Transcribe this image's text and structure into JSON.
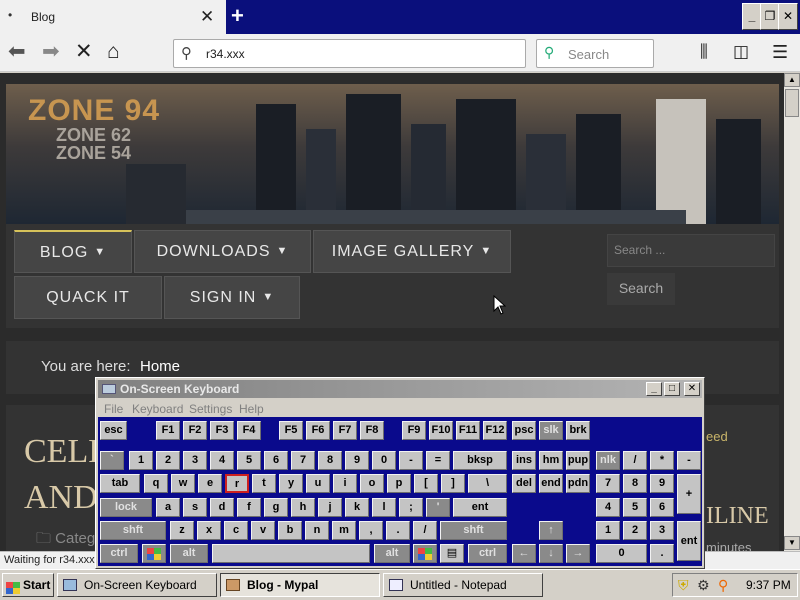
{
  "browser": {
    "tab_title": "Blog",
    "tab_close": "✕",
    "new_tab": "+",
    "url": "r34.xxx",
    "search_placeholder": "Search",
    "status": "Waiting for r34.xxx..."
  },
  "site": {
    "logo_main": "ZONE 94",
    "logo_sub1": "ZONE 62",
    "logo_sub2": "ZONE 54",
    "menu": [
      {
        "label": "BLOG"
      },
      {
        "label": "DOWNLOADS"
      },
      {
        "label": "IMAGE GALLERY"
      },
      {
        "label": "QUACK IT"
      },
      {
        "label": "SIGN IN"
      }
    ],
    "search_placeholder": "Search ...",
    "search_button": "Search",
    "breadcrumb_label": "You are here:",
    "breadcrumb_link": "Home",
    "headline_line1": "CELLO",
    "headline_line2": "AND",
    "category": "Categ",
    "feed": "eed",
    "online": "ILINE",
    "minutes": "minutes"
  },
  "osk": {
    "title": "On-Screen Keyboard",
    "menu": [
      "File",
      "Keyboard",
      "Settings",
      "Help"
    ],
    "keys": {
      "row0": [
        "esc",
        "F1",
        "F2",
        "F3",
        "F4",
        "F5",
        "F6",
        "F7",
        "F8",
        "F9",
        "F10",
        "F11",
        "F12",
        "psc",
        "slk",
        "brk"
      ],
      "row1": [
        "`",
        "1",
        "2",
        "3",
        "4",
        "5",
        "6",
        "7",
        "8",
        "9",
        "0",
        "-",
        "=",
        "bksp",
        "ins",
        "hm",
        "pup",
        "nlk",
        "/",
        "*",
        "-"
      ],
      "row2": [
        "tab",
        "q",
        "w",
        "e",
        "r",
        "t",
        "y",
        "u",
        "i",
        "o",
        "p",
        "[",
        "]",
        "\\",
        "del",
        "end",
        "pdn",
        "7",
        "8",
        "9",
        "+"
      ],
      "row3": [
        "lock",
        "a",
        "s",
        "d",
        "f",
        "g",
        "h",
        "j",
        "k",
        "l",
        ";",
        "'",
        "ent",
        "4",
        "5",
        "6"
      ],
      "row4": [
        "shft",
        "z",
        "x",
        "c",
        "v",
        "b",
        "n",
        "m",
        ",",
        ".",
        "/",
        "shft",
        "↑",
        "1",
        "2",
        "3",
        "ent"
      ],
      "row5": [
        "ctrl",
        "alt",
        "alt",
        "ctrl",
        "←",
        "↓",
        "→",
        "0",
        "."
      ]
    }
  },
  "taskbar": {
    "start": "Start",
    "tasks": [
      "On-Screen Keyboard",
      "Blog - Mypal",
      "Untitled - Notepad"
    ],
    "clock": "9:37 PM"
  }
}
